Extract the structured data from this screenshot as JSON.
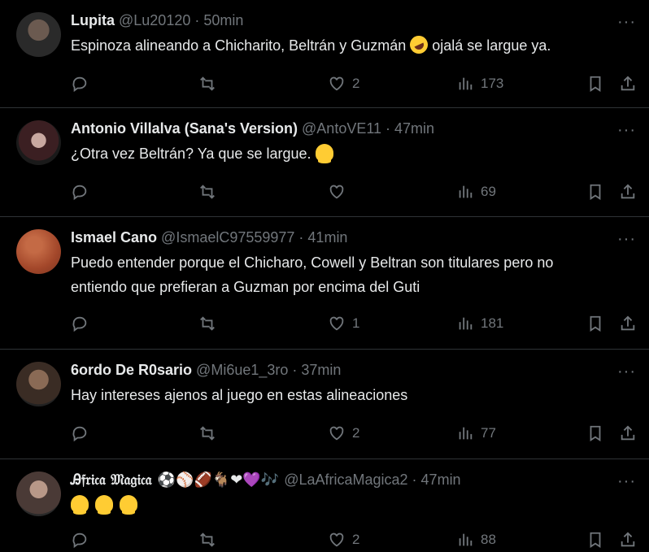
{
  "tweets": [
    {
      "name": "Lupita",
      "handle": "@Lu20120",
      "time": "50min",
      "text_before": "Espinoza alineando a Chicharito, Beltrán y Guzmán",
      "text_after": "ojalá se largue ya.",
      "emoji": "rolling-on-floor-laughing",
      "likes": "2",
      "views": "173",
      "avatar_color": "#3a3a3a"
    },
    {
      "name": "Antonio Villalva (Sana's Version)",
      "handle": "@AntoVE11",
      "time": "47min",
      "text_before": "¿Otra vez Beltrán? Ya que se largue.",
      "emoji": "melting-face",
      "likes": "",
      "views": "69",
      "avatar_color": "#2b2b2b"
    },
    {
      "name": "Ismael Cano",
      "handle": "@IsmaelC97559977",
      "time": "41min",
      "text_line1": "Puedo entender porque el Chicharo, Cowell y Beltran son titulares pero no",
      "text_line2": "entiendo que prefieran a Guzman por encima del Guti",
      "likes": "1",
      "views": "181",
      "avatar_color": "#b4502f"
    },
    {
      "name": "6ordo De R0sario",
      "handle": "@Mi6ue1_3ro",
      "time": "37min",
      "text_before": "Hay intereses ajenos al juego en estas alineaciones",
      "likes": "2",
      "views": "77",
      "avatar_color": "#5a4a3e"
    },
    {
      "name": "Ꭿ𝔣𝔯𝔦𝔠𝔞 𝔐𝔞𝔤𝔦𝔠𝔞",
      "name_emojis": "⚽⚾🏈🐐❤💜🎶",
      "handle": "@LaAfricaMagica2",
      "time": "47min",
      "emoji": "melting-face",
      "likes": "2",
      "views": "88",
      "avatar_color": "#6d6d6d"
    }
  ],
  "more_label": "···",
  "separator": "·",
  "icons": {
    "reply": "reply-icon",
    "retweet": "retweet-icon",
    "like": "heart-icon",
    "views": "views-icon",
    "bookmark": "bookmark-icon",
    "share": "share-icon"
  }
}
